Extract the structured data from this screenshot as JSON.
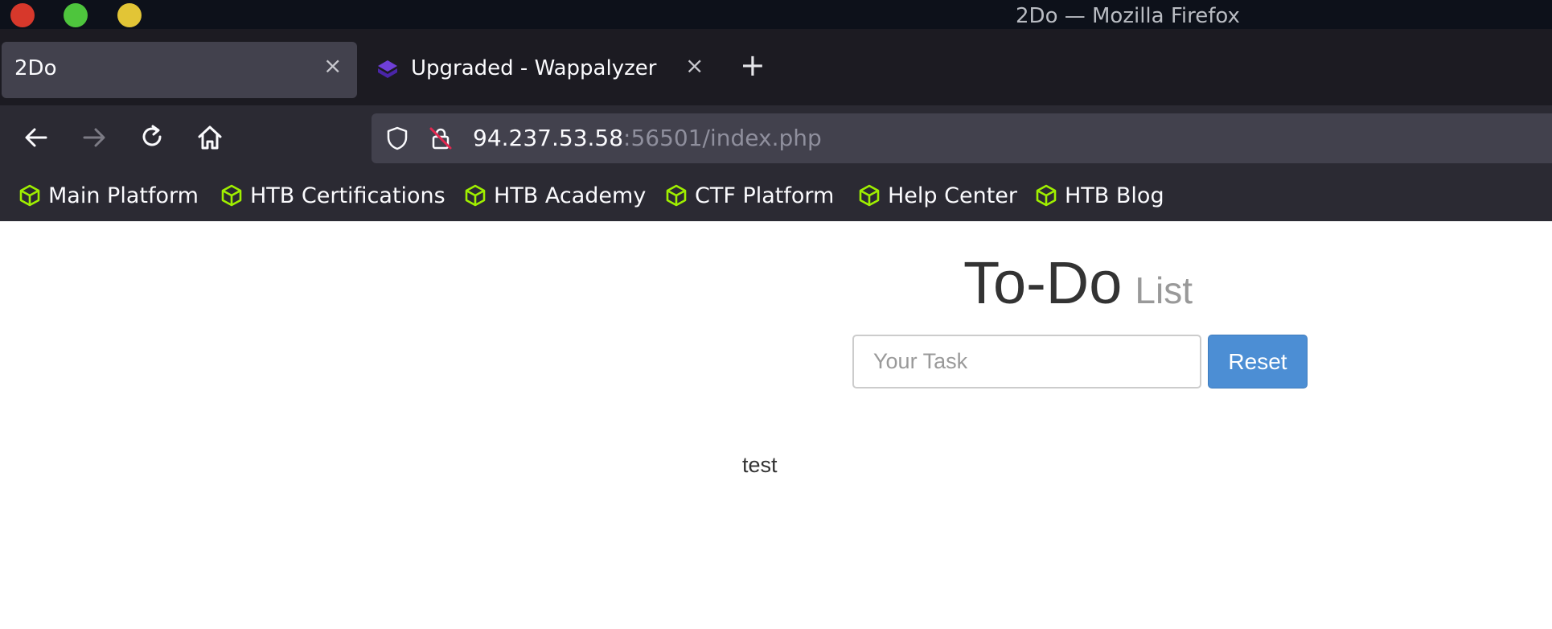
{
  "window": {
    "title": "2Do — Mozilla Firefox"
  },
  "tabs": [
    {
      "label": "2Do",
      "active": true,
      "icon": "none"
    },
    {
      "label": "Upgraded - Wappalyzer",
      "active": false,
      "icon": "wappalyzer-icon"
    }
  ],
  "navbar": {
    "url_host": "94.237.53.58",
    "url_rest": ":56501/index.php"
  },
  "bookmarks": [
    {
      "label": "Main Platform",
      "icon": "htb-cube-icon"
    },
    {
      "label": "HTB Certifications",
      "icon": "htb-cube-icon"
    },
    {
      "label": "HTB Academy",
      "icon": "htb-cube-icon"
    },
    {
      "label": "CTF Platform",
      "icon": "htb-cube-icon"
    },
    {
      "label": "Help Center",
      "icon": "htb-cube-icon"
    },
    {
      "label": "HTB Blog",
      "icon": "htb-cube-icon"
    }
  ],
  "page": {
    "heading_main": "To-Do",
    "heading_sub": "List",
    "task_placeholder": "Your Task",
    "task_value": "",
    "reset_label": "Reset",
    "items": [
      "test"
    ]
  },
  "colors": {
    "bookmark_icon": "#9fef00",
    "reset_button": "#4c8ed4",
    "window_close": "#d7382b",
    "window_maximize": "#4ec53d",
    "window_minimize": "#e2c536"
  }
}
